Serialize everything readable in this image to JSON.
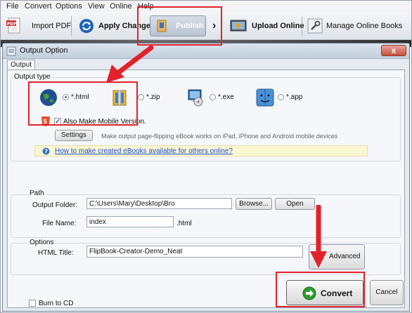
{
  "menu": [
    "File",
    "Convert",
    "Options",
    "View",
    "Online",
    "Help"
  ],
  "toolbar": {
    "import_pdf": "Import PDF",
    "apply_change": "Apply Change",
    "publish": "Publish",
    "upload_online": "Upload Online",
    "manage_online_books": "Manage Online Books"
  },
  "dialog": {
    "title": "Output Option",
    "close": "x",
    "tab": "Output",
    "output_type": {
      "title": "Output type",
      "options": [
        "*.html",
        "*.zip",
        "*.exe",
        "*.app"
      ],
      "selected": "*.html",
      "mobile_checkbox": "Also Make Mobile Version.",
      "mobile_checked": true,
      "settings_button": "Settings",
      "settings_hint": "Make output page-flipping eBook works on iPad, iPhone and Android mobile devices",
      "help_link": "How to make created eBooks available for others online?"
    },
    "path": {
      "title": "Path",
      "output_folder_label": "Output Folder:",
      "output_folder_value": "C:\\Users\\Mary\\Desktop\\Bro",
      "browse_button": "Browse...",
      "open_button": "Open",
      "file_name_label": "File Name:",
      "file_name_value": "index",
      "file_ext": ".html"
    },
    "options": {
      "title": "Options",
      "html_title_label": "HTML Title:",
      "html_title_value": "FlipBook-Creator-Demo_Neat",
      "advanced_button": "Advanced"
    },
    "burn_to_cd": "Burn to CD",
    "burn_checked": false,
    "convert_button": "Convert",
    "cancel_button": "Cancel"
  },
  "colors": {
    "highlight_red": "#e2222a",
    "convert_arrow_green": "#2e9e2e"
  }
}
